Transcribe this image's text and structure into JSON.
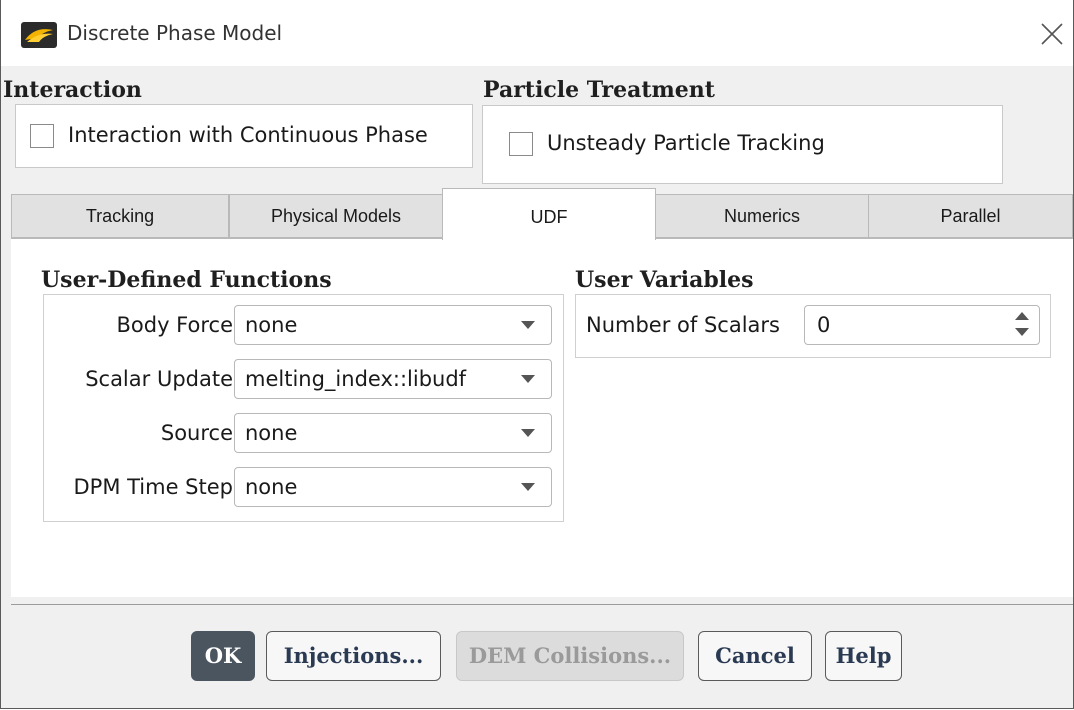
{
  "window": {
    "title": "Discrete Phase Model",
    "icon": "ansys-fluent-icon",
    "close_icon": "close-icon"
  },
  "interaction": {
    "heading": "Interaction",
    "checkbox_label": "Interaction with Continuous Phase",
    "checked": false
  },
  "particle_treatment": {
    "heading": "Particle Treatment",
    "checkbox_label": "Unsteady Particle Tracking",
    "checked": false
  },
  "tabs": [
    {
      "label": "Tracking",
      "active": false
    },
    {
      "label": "Physical Models",
      "active": false
    },
    {
      "label": "UDF",
      "active": true
    },
    {
      "label": "Numerics",
      "active": false
    },
    {
      "label": "Parallel",
      "active": false
    }
  ],
  "udf": {
    "heading": "User-Defined Functions",
    "fields": [
      {
        "label": "Body Force",
        "value": "none"
      },
      {
        "label": "Scalar Update",
        "value": "melting_index::libudf"
      },
      {
        "label": "Source",
        "value": "none"
      },
      {
        "label": "DPM Time Step",
        "value": "none"
      }
    ]
  },
  "user_variables": {
    "heading": "User Variables",
    "label": "Number of Scalars",
    "value": "0"
  },
  "buttons": [
    {
      "label": "OK",
      "style": "primary"
    },
    {
      "label": "Injections...",
      "style": "normal"
    },
    {
      "label": "DEM Collisions...",
      "style": "disabled"
    },
    {
      "label": "Cancel",
      "style": "normal"
    },
    {
      "label": "Help",
      "style": "normal"
    }
  ],
  "colors": {
    "primary_button": "#4b5560",
    "disabled_text": "#9a9a9a",
    "heading_text": "#1f1f1f",
    "panel_bg": "#ffffff",
    "dialog_bg": "#f0f0f0"
  }
}
